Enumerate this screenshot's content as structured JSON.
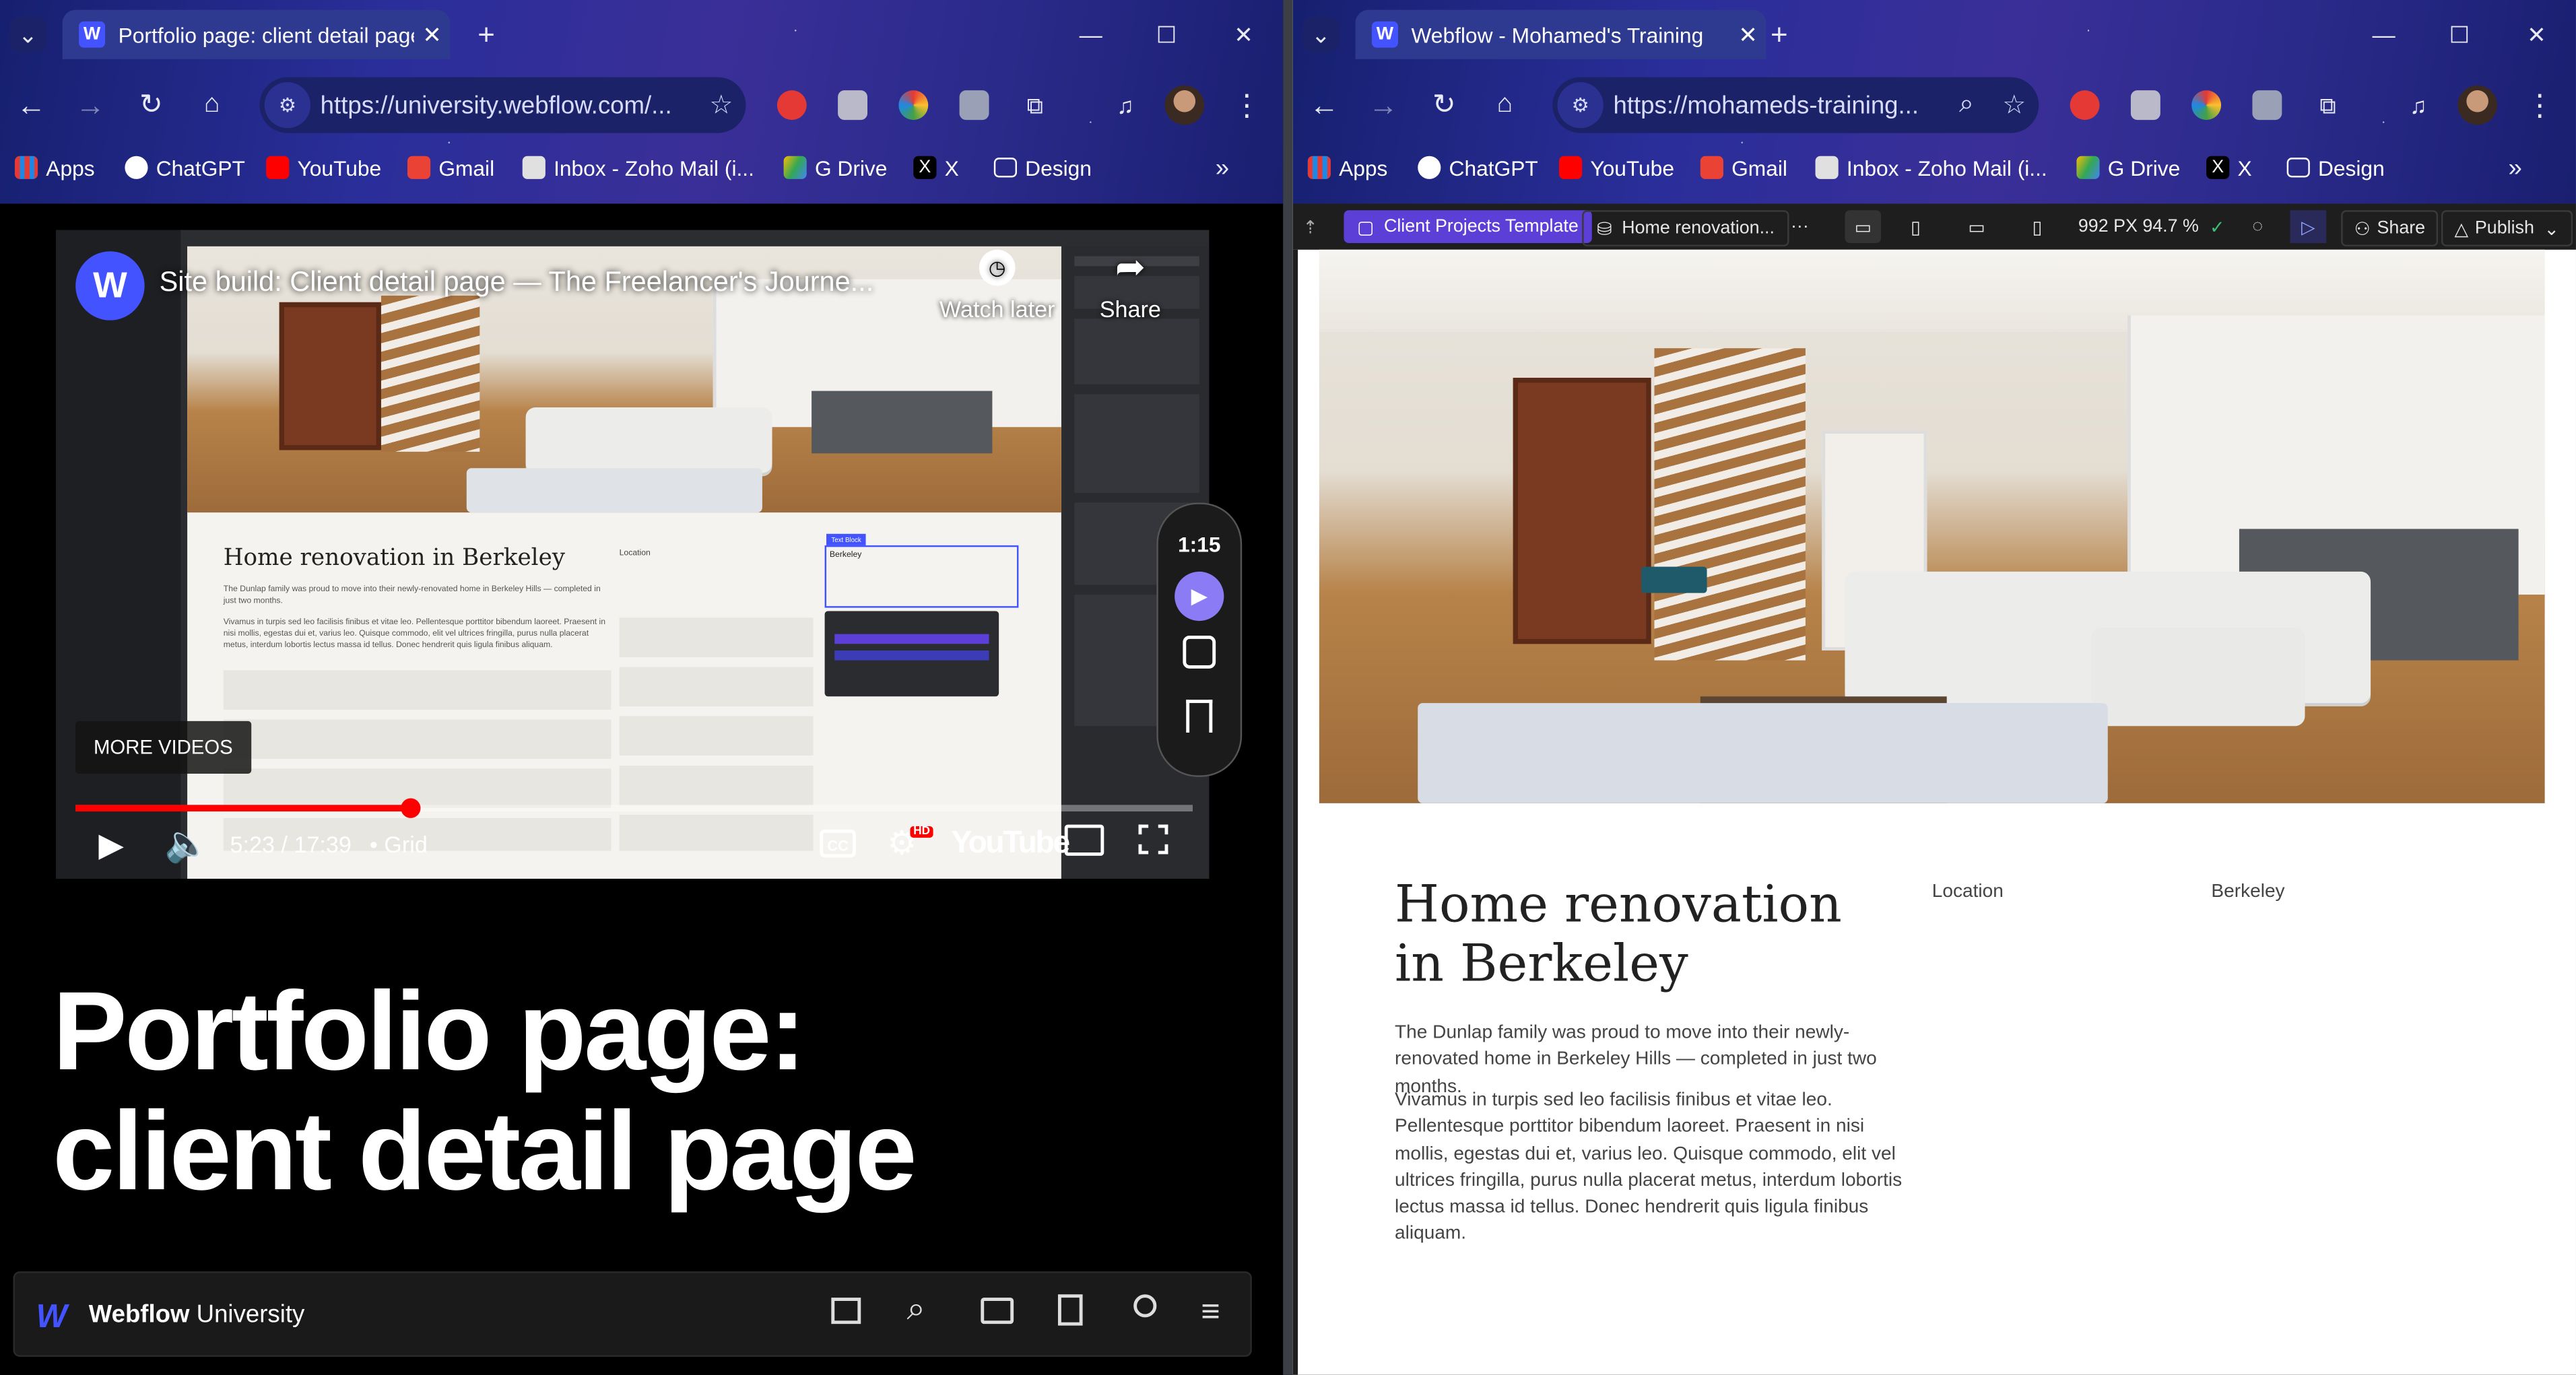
{
  "left_window": {
    "tab_title": "Portfolio page: client detail page",
    "url": "https://university.webflow.com/...",
    "bookmarks": [
      "Apps",
      "ChatGPT",
      "YouTube",
      "Gmail",
      "Inbox - Zoho Mail (i...",
      "G Drive",
      "X",
      "Design"
    ],
    "video": {
      "title": "Site build: Client detail page — The Freelancer's Journe...",
      "watch_later": "Watch later",
      "share": "Share",
      "more_videos": "MORE VIDEOS",
      "time": "5:23 / 17:39",
      "chapter": "• Grid",
      "youtube": "YouTube",
      "hd": "HD",
      "progress": 0.3,
      "timer": "1:15",
      "canvas_heading": "Home renovation in Berkeley",
      "canvas_location": "Location",
      "canvas_berkeley": "Berkeley",
      "canvas_para1": "The Dunlap family was proud to move into their newly-renovated home in Berkeley Hills — completed in just two months.",
      "canvas_para2": "Vivamus in turpis sed leo facilisis finibus et vitae leo. Pellentesque porttitor bibendum laoreet. Praesent in nisi mollis, egestas dui et, varius leo. Quisque commodo, elit vel ultrices fringilla, purus nulla placerat metus, interdum lobortis lectus massa id tellus. Donec hendrerit quis ligula finibus aliquam."
    },
    "page_title_line1": "Portfolio page:",
    "page_title_line2": "client detail page",
    "footer_brand": "Webflow",
    "footer_brand2": "University"
  },
  "right_window": {
    "tab_title": "Webflow - Mohamed's Training",
    "url": "https://mohameds-training...",
    "bookmarks": [
      "Apps",
      "ChatGPT",
      "YouTube",
      "Gmail",
      "Inbox - Zoho Mail (i...",
      "G Drive",
      "X",
      "Design"
    ],
    "designer": {
      "template": "Client Projects Template",
      "page": "Home renovation...",
      "more": "···",
      "size": "992 PX 94.7 %",
      "share": "Share",
      "publish": "Publish"
    },
    "content": {
      "heading": "Home renovation in Berkeley",
      "para1": "The Dunlap family was proud to move into their newly-renovated home in Berkeley Hills — completed in just two months.",
      "para2": "Vivamus in turpis sed leo facilisis finibus et vitae leo. Pellentesque porttitor bibendum laoreet. Praesent in nisi mollis, egestas dui et, varius leo. Quisque commodo, elit vel ultrices fringilla, purus nulla placerat metus, interdum lobortis lectus massa id tellus. Donec hendrerit quis ligula finibus aliquam.",
      "location_label": "Location",
      "location_value": "Berkeley"
    }
  },
  "colors": {
    "webflow_blue": "#4353ff",
    "youtube_red": "#ff0000",
    "designer_bar": "#1e1e1e",
    "template_badge": "#5b3fd6"
  }
}
